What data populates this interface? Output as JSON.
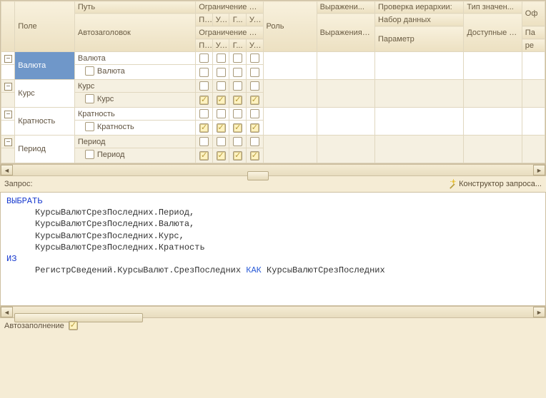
{
  "headers": {
    "field": "Поле",
    "path": "Путь",
    "autotitle": "Автозаголовок",
    "field_restrict": "Ограничение поля",
    "record_restrict": "Ограничение рек...",
    "p": "П...",
    "u": "У...",
    "g": "Г...",
    "u2": "У...",
    "role": "Роль",
    "expr": "Выражени...",
    "order_expr": "Выражения упорядочив...",
    "hier": "Проверка иерархии:",
    "dataset": "Набор данных",
    "param": "Параметр",
    "valtype": "Тип значен...",
    "avail": "Доступные значения",
    "of": "Оф",
    "pa": "Па",
    "re": "ре"
  },
  "rows": [
    {
      "field": "Валюта",
      "path": "Валюта",
      "child": "Валюта",
      "selected": true,
      "mainChecks": [
        false,
        false,
        false,
        false
      ],
      "childChecks": [
        false,
        false,
        false,
        false
      ]
    },
    {
      "field": "Курс",
      "path": "Курс",
      "child": "Курс",
      "selected": false,
      "mainChecks": [
        false,
        false,
        false,
        false
      ],
      "childChecks": [
        true,
        true,
        true,
        true
      ]
    },
    {
      "field": "Кратность",
      "path": "Кратность",
      "child": "Кратность",
      "selected": false,
      "mainChecks": [
        false,
        false,
        false,
        false
      ],
      "childChecks": [
        true,
        true,
        true,
        true
      ]
    },
    {
      "field": "Период",
      "path": "Период",
      "child": "Период",
      "selected": false,
      "mainChecks": [
        false,
        false,
        false,
        false
      ],
      "childChecks": [
        true,
        true,
        true,
        true
      ]
    }
  ],
  "query_label": "Запрос:",
  "constructor_label": "Конструктор запроса...",
  "code": {
    "kw_select": "ВЫБРАТЬ",
    "l1": "КурсыВалютСрезПоследних.Период,",
    "l2": "КурсыВалютСрезПоследних.Валюта,",
    "l3": "КурсыВалютСрезПоследних.Курс,",
    "l4": "КурсыВалютСрезПоследних.Кратность",
    "kw_from": "ИЗ",
    "l5a": "РегистрСведений.КурсыВалют.СрезПоследних ",
    "kw_as": "КАК",
    "l5b": " КурсыВалютСрезПоследних"
  },
  "autofill_label": "Автозаполнение",
  "autofill_checked": true
}
